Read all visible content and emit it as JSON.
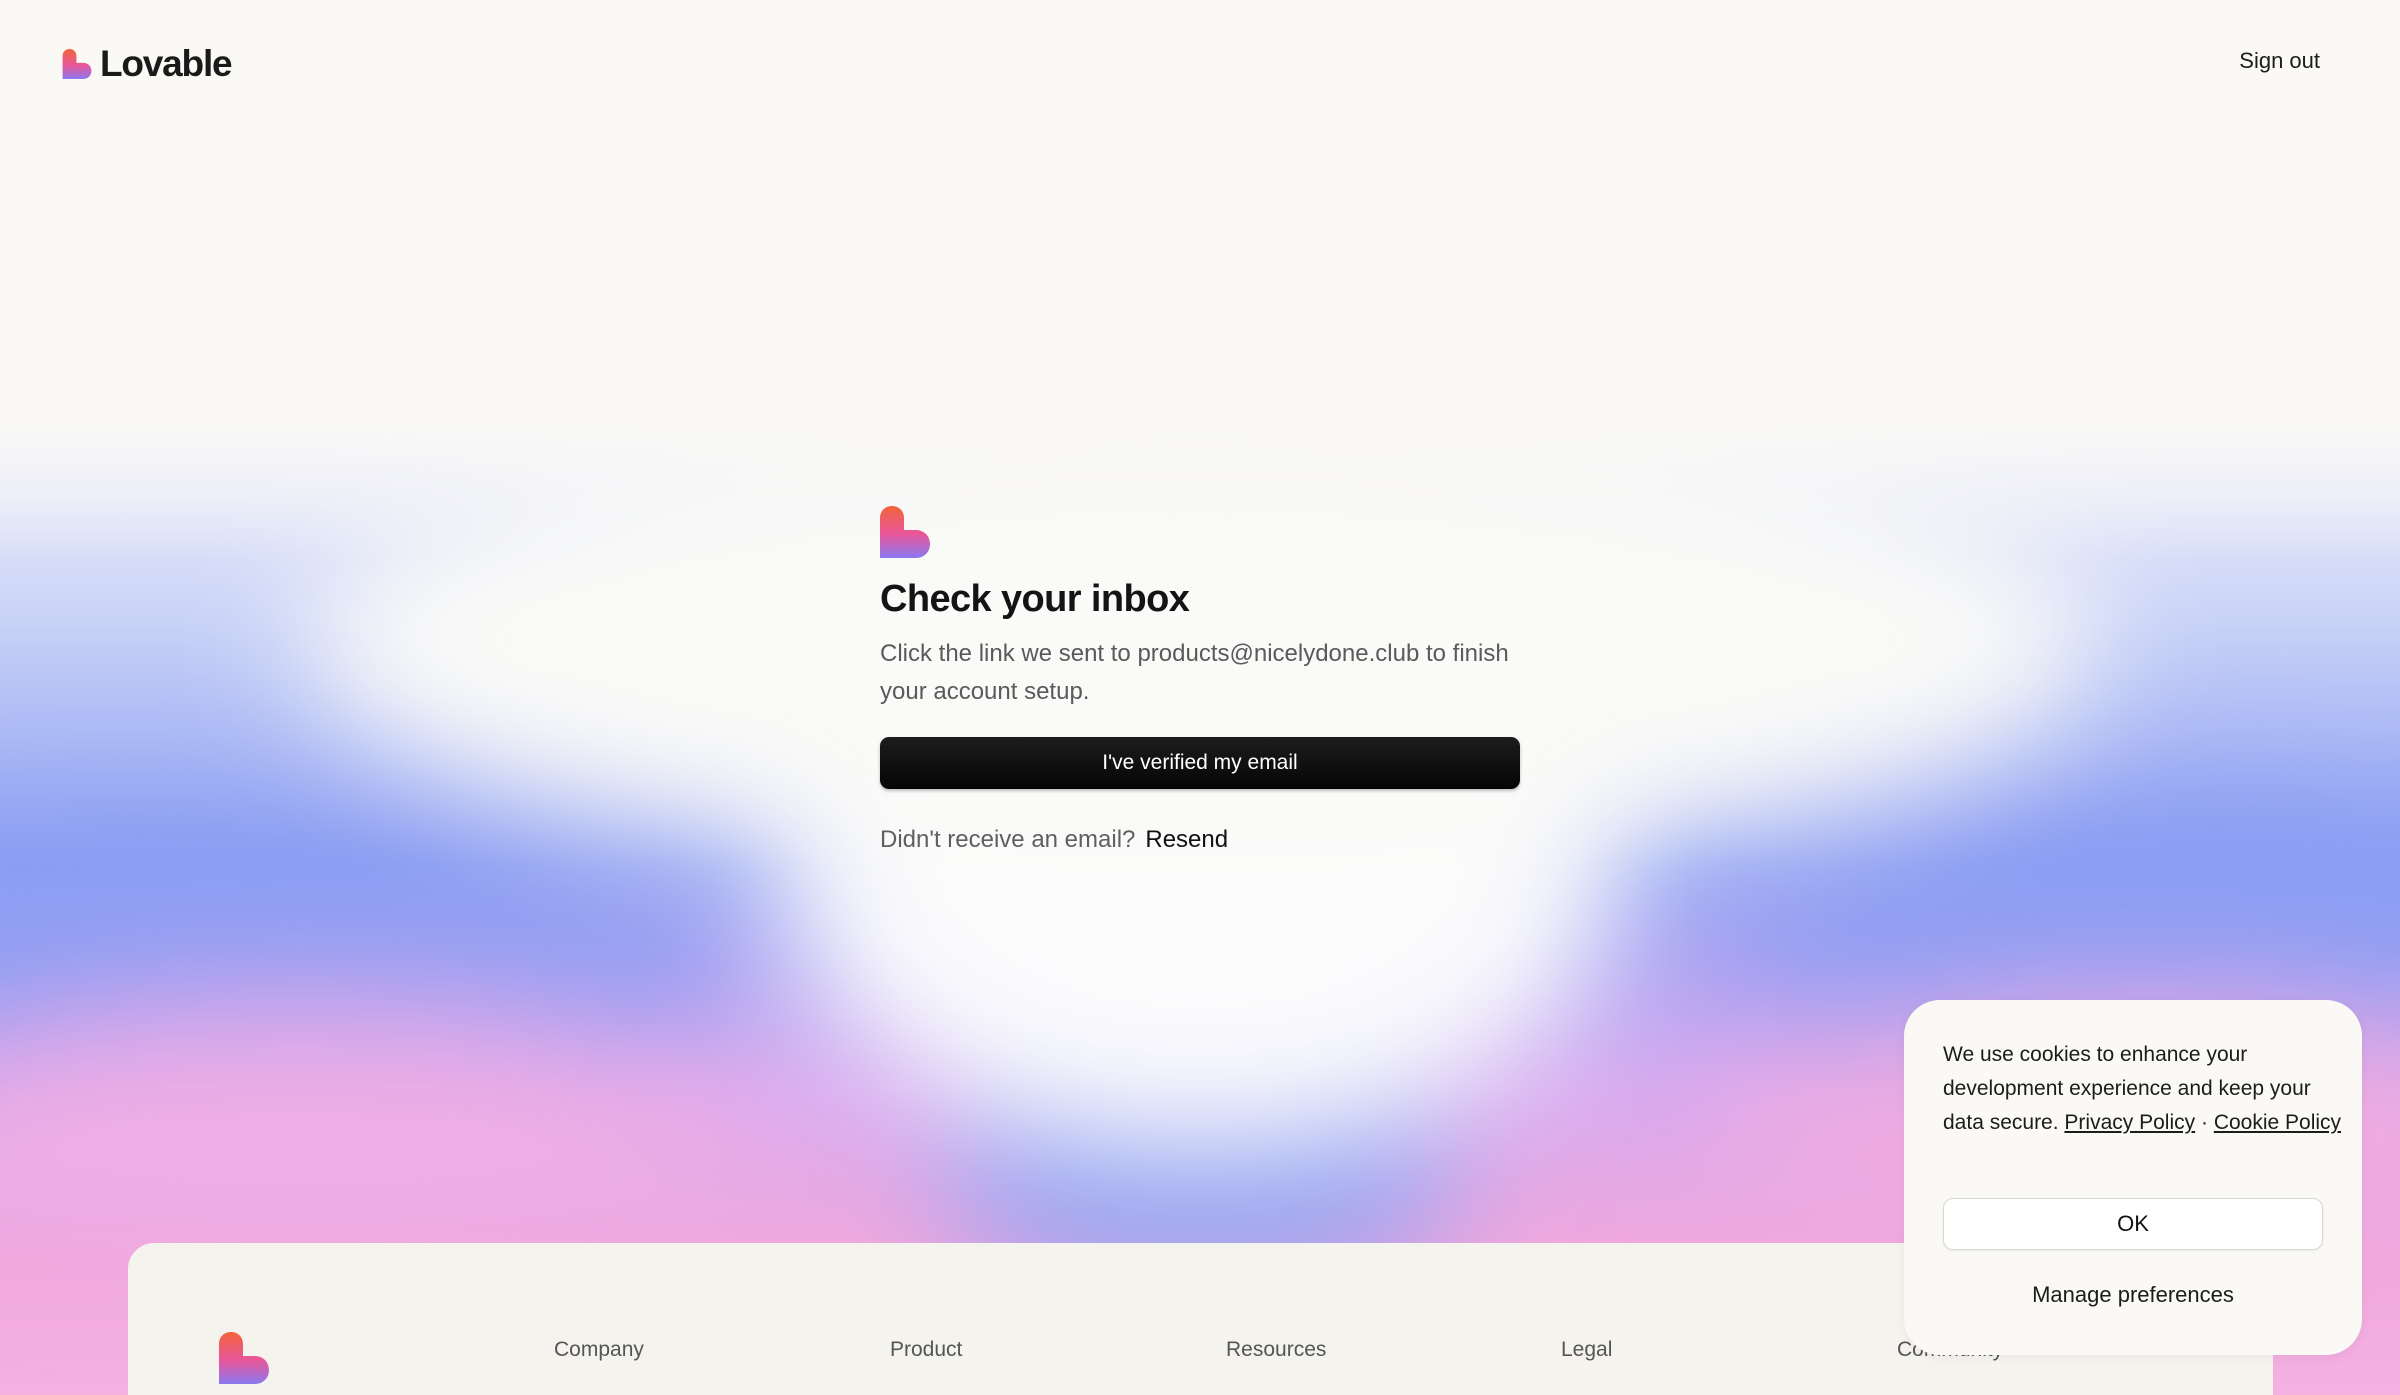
{
  "header": {
    "brand": "Lovable",
    "sign_out": "Sign out"
  },
  "main": {
    "title": "Check your inbox",
    "description": "Click the link we sent to products@nicelydone.club to finish your account setup.",
    "verify_button": "I've verified my email",
    "resend_prompt": "Didn't receive an email?",
    "resend_link": "Resend"
  },
  "footer": {
    "columns": [
      "Company",
      "Product",
      "Resources",
      "Legal",
      "Community"
    ]
  },
  "cookie": {
    "text": "We use cookies to enhance your development experience and keep your data secure.",
    "privacy_link": "Privacy Policy",
    "separator": "·",
    "cookie_link": "Cookie Policy",
    "ok": "OK",
    "manage": "Manage preferences"
  },
  "colors": {
    "background": "#faf9f6",
    "wave_blue": "#8a9cf2",
    "wave_pink": "#f0a8dc",
    "button": "#0a0a0a",
    "logo_orange": "#f2633a",
    "logo_pink": "#e8579b",
    "logo_purple": "#8a78f0"
  }
}
